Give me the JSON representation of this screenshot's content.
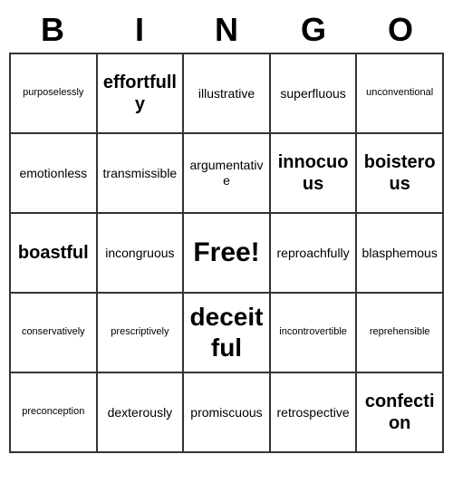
{
  "header": {
    "letters": [
      "B",
      "I",
      "N",
      "G",
      "O"
    ]
  },
  "grid": [
    [
      {
        "text": "purposelessly",
        "size": "small"
      },
      {
        "text": "effortfully",
        "size": "large"
      },
      {
        "text": "illustrative",
        "size": "medium"
      },
      {
        "text": "superfluous",
        "size": "medium"
      },
      {
        "text": "unconventional",
        "size": "small"
      }
    ],
    [
      {
        "text": "emotionless",
        "size": "medium"
      },
      {
        "text": "transmissible",
        "size": "medium"
      },
      {
        "text": "argumentative",
        "size": "medium"
      },
      {
        "text": "innocuous",
        "size": "large"
      },
      {
        "text": "boisterous",
        "size": "large"
      }
    ],
    [
      {
        "text": "boastful",
        "size": "large"
      },
      {
        "text": "incongruous",
        "size": "medium"
      },
      {
        "text": "Free!",
        "size": "free"
      },
      {
        "text": "reproachfully",
        "size": "medium"
      },
      {
        "text": "blasphemous",
        "size": "medium"
      }
    ],
    [
      {
        "text": "conservatively",
        "size": "small"
      },
      {
        "text": "prescriptively",
        "size": "small"
      },
      {
        "text": "deceitful",
        "size": "xlarge"
      },
      {
        "text": "incontrovertible",
        "size": "small"
      },
      {
        "text": "reprehensible",
        "size": "small"
      }
    ],
    [
      {
        "text": "preconception",
        "size": "small"
      },
      {
        "text": "dexterously",
        "size": "medium"
      },
      {
        "text": "promiscuous",
        "size": "medium"
      },
      {
        "text": "retrospective",
        "size": "medium"
      },
      {
        "text": "confection",
        "size": "large"
      }
    ]
  ]
}
